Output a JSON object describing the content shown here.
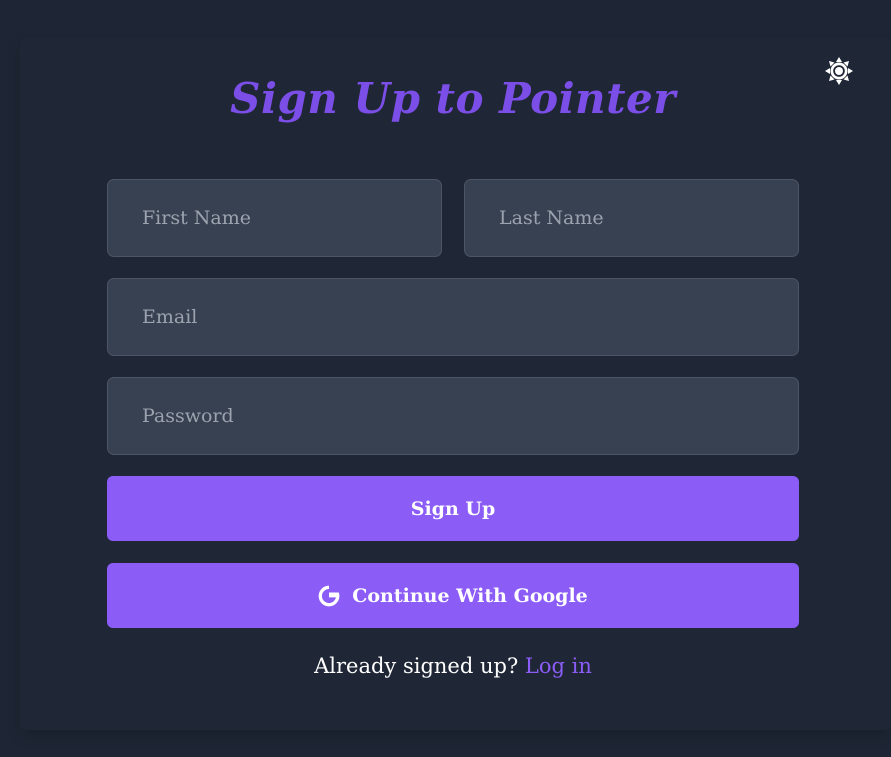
{
  "page": {
    "title": "Sign Up to Pointer"
  },
  "theme_toggle": {
    "icon": "sun-icon",
    "color": "#ffffff"
  },
  "form": {
    "first_name": {
      "placeholder": "First Name",
      "value": ""
    },
    "last_name": {
      "placeholder": "Last Name",
      "value": ""
    },
    "email": {
      "placeholder": "Email",
      "value": ""
    },
    "password": {
      "placeholder": "Password",
      "value": ""
    },
    "signup_label": "Sign Up",
    "google_label": "Continue With Google",
    "google_icon": "google-icon"
  },
  "footer": {
    "prompt": "Already signed up?",
    "link_label": "Log in"
  },
  "colors": {
    "background": "#1e2635",
    "accent": "#8b5cf6",
    "title": "#7c4ee8",
    "field_bg": "#374151",
    "field_border": "#4b5563",
    "placeholder": "#9ca3af"
  }
}
